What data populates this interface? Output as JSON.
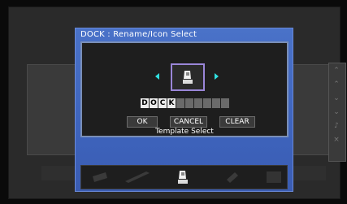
{
  "dialog": {
    "title": "DOCK : Rename/Icon Select",
    "name_chars": [
      "D",
      "O",
      "C",
      "K",
      "",
      "",
      "",
      "",
      "",
      ""
    ],
    "buttons": {
      "ok": "OK",
      "cancel": "CANCEL",
      "clear": "CLEAR"
    },
    "template_label": "Template Select",
    "selected_icon": "dock-icon"
  },
  "tray": {
    "icons": [
      "tv-icon-dim",
      "disc-player-icon-dim",
      "dock-icon-selected",
      "game-icon-dim",
      "audio-rack-icon-dim"
    ]
  },
  "side_bar": {
    "buttons": [
      "double-chevron-up-icon",
      "chevron-up-icon",
      "chevron-down-icon",
      "double-chevron-down-icon",
      "music-note-icon",
      "close-icon"
    ]
  },
  "colors": {
    "dialog_blue": "#4a72c8",
    "selection_border": "#9a86d8",
    "arrow_cyan": "#30e0e0"
  }
}
